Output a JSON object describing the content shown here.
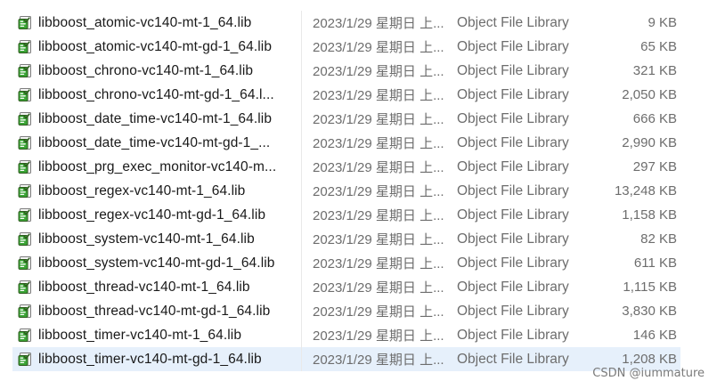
{
  "files": [
    {
      "name": "libboost_atomic-vc140-mt-1_64.lib",
      "date": "2023/1/29 星期日 上...",
      "type": "Object File Library",
      "size": "9 KB"
    },
    {
      "name": "libboost_atomic-vc140-mt-gd-1_64.lib",
      "date": "2023/1/29 星期日 上...",
      "type": "Object File Library",
      "size": "65 KB"
    },
    {
      "name": "libboost_chrono-vc140-mt-1_64.lib",
      "date": "2023/1/29 星期日 上...",
      "type": "Object File Library",
      "size": "321 KB"
    },
    {
      "name": "libboost_chrono-vc140-mt-gd-1_64.l...",
      "date": "2023/1/29 星期日 上...",
      "type": "Object File Library",
      "size": "2,050 KB"
    },
    {
      "name": "libboost_date_time-vc140-mt-1_64.lib",
      "date": "2023/1/29 星期日 上...",
      "type": "Object File Library",
      "size": "666 KB"
    },
    {
      "name": "libboost_date_time-vc140-mt-gd-1_...",
      "date": "2023/1/29 星期日 上...",
      "type": "Object File Library",
      "size": "2,990 KB"
    },
    {
      "name": "libboost_prg_exec_monitor-vc140-m...",
      "date": "2023/1/29 星期日 上...",
      "type": "Object File Library",
      "size": "297 KB"
    },
    {
      "name": "libboost_regex-vc140-mt-1_64.lib",
      "date": "2023/1/29 星期日 上...",
      "type": "Object File Library",
      "size": "13,248 KB"
    },
    {
      "name": "libboost_regex-vc140-mt-gd-1_64.lib",
      "date": "2023/1/29 星期日 上...",
      "type": "Object File Library",
      "size": "1,158 KB"
    },
    {
      "name": "libboost_system-vc140-mt-1_64.lib",
      "date": "2023/1/29 星期日 上...",
      "type": "Object File Library",
      "size": "82 KB"
    },
    {
      "name": "libboost_system-vc140-mt-gd-1_64.lib",
      "date": "2023/1/29 星期日 上...",
      "type": "Object File Library",
      "size": "611 KB"
    },
    {
      "name": "libboost_thread-vc140-mt-1_64.lib",
      "date": "2023/1/29 星期日 上...",
      "type": "Object File Library",
      "size": "1,115 KB"
    },
    {
      "name": "libboost_thread-vc140-mt-gd-1_64.lib",
      "date": "2023/1/29 星期日 上...",
      "type": "Object File Library",
      "size": "3,830 KB"
    },
    {
      "name": "libboost_timer-vc140-mt-1_64.lib",
      "date": "2023/1/29 星期日 上...",
      "type": "Object File Library",
      "size": "146 KB"
    },
    {
      "name": "libboost_timer-vc140-mt-gd-1_64.lib",
      "date": "2023/1/29 星期日 上...",
      "type": "Object File Library",
      "size": "1,208 KB",
      "selected": true
    }
  ],
  "file_icon": "lib-file-icon",
  "colors": {
    "selected_row": "#e6f0fb",
    "icon_green": "#3aa335",
    "icon_dark": "#2e5c1e"
  },
  "watermark": "CSDN @iummature"
}
